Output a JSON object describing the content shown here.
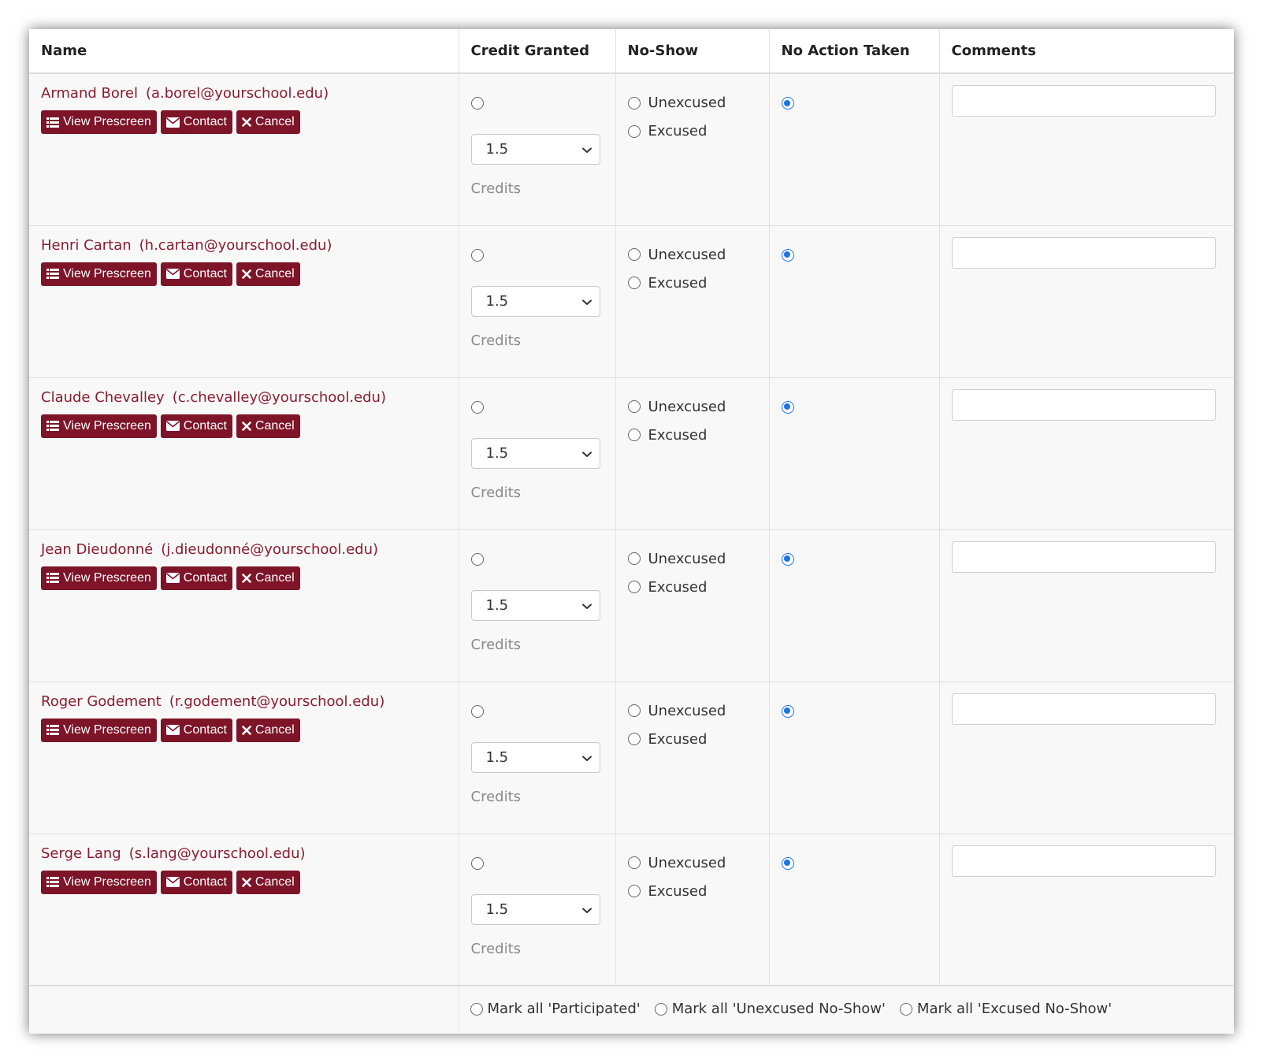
{
  "table": {
    "headers": {
      "name": "Name",
      "credit": "Credit Granted",
      "noshow": "No-Show",
      "noaction": "No Action Taken",
      "comments": "Comments"
    },
    "buttons": {
      "view": "View Prescreen",
      "contact": "Contact",
      "cancel": "Cancel"
    },
    "noshow_options": {
      "unexcused": "Unexcused",
      "excused": "Excused"
    },
    "credits_label": "Credits",
    "rows": [
      {
        "name": "Armand Borel",
        "email": "(a.borel@yourschool.edu)",
        "credit_value": "1.5",
        "credit_granted": false,
        "unexcused": false,
        "excused": false,
        "no_action": true,
        "comment": ""
      },
      {
        "name": "Henri Cartan",
        "email": "(h.cartan@yourschool.edu)",
        "credit_value": "1.5",
        "credit_granted": false,
        "unexcused": false,
        "excused": false,
        "no_action": true,
        "comment": ""
      },
      {
        "name": "Claude Chevalley",
        "email": "(c.chevalley@yourschool.edu)",
        "credit_value": "1.5",
        "credit_granted": false,
        "unexcused": false,
        "excused": false,
        "no_action": true,
        "comment": ""
      },
      {
        "name": "Jean Dieudonné",
        "email": "(j.dieudonné@yourschool.edu)",
        "credit_value": "1.5",
        "credit_granted": false,
        "unexcused": false,
        "excused": false,
        "no_action": true,
        "comment": ""
      },
      {
        "name": "Roger Godement",
        "email": "(r.godement@yourschool.edu)",
        "credit_value": "1.5",
        "credit_granted": false,
        "unexcused": false,
        "excused": false,
        "no_action": true,
        "comment": ""
      },
      {
        "name": "Serge Lang",
        "email": "(s.lang@yourschool.edu)",
        "credit_value": "1.5",
        "credit_granted": false,
        "unexcused": false,
        "excused": false,
        "no_action": true,
        "comment": ""
      }
    ],
    "footer": {
      "mark_participated": "Mark all 'Participated'",
      "mark_unexcused": "Mark all 'Unexcused No-Show'",
      "mark_excused": "Mark all 'Excused No-Show'"
    }
  },
  "icons": {
    "view": "list-icon",
    "contact": "envelope-icon",
    "cancel": "x-icon",
    "select": "chevron-down-icon"
  },
  "colors": {
    "button_bg": "#7d1428",
    "name_text": "#8a1c2e",
    "radio_checked": "#1a73e8"
  }
}
